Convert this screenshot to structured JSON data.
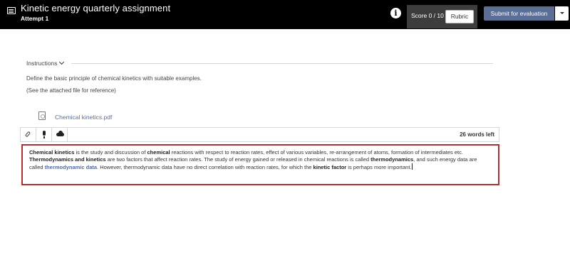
{
  "header": {
    "title": "Kinetic energy quarterly assignment",
    "subtitle": "Attempt 1",
    "info_icon": "info-icon",
    "score_label": "Score 0 / 10",
    "rubric_label": "Rubric",
    "submit_label": "Submit for evaluation"
  },
  "instructions": {
    "heading": "Instructions",
    "line1": "Define the basic principle of chemical kinetics with suitable examples.",
    "line2": "(See the attached file for reference)",
    "attachment": "Chemical kinetics.pdf"
  },
  "editor": {
    "tools": [
      "paperclip-icon",
      "microphone-icon",
      "cloud-icon"
    ],
    "words_left": "26 words left",
    "answer": {
      "p1_term": "Chemical kinetics",
      "p1_a": " is the study and discussion of ",
      "p1_b_term": "chemical",
      "p1_c": " reactions with respect to reaction rates, effect of various variables, re-arrangement of atoms, formation of intermediates etc.",
      "p2_term": "Thermodynamics and kinetics",
      "p2_a": " are two factors that affect reaction rates. The study of energy gained or released in chemical reactions is called ",
      "p2_b_term": "thermodynamics",
      "p2_c": ", and such energy data are called ",
      "p2_d_term": "thermodynamic data",
      "p2_e": ". However, thermodynamic data have no direct correlation with reaction rates, for which the ",
      "p2_f_term": "kinetic factor",
      "p2_g": " is perhaps more important."
    }
  },
  "colors": {
    "header_bg": "#000000",
    "submit_bg": "#5b6e95",
    "highlight_border": "#a83232",
    "link": "#5b6e95"
  }
}
